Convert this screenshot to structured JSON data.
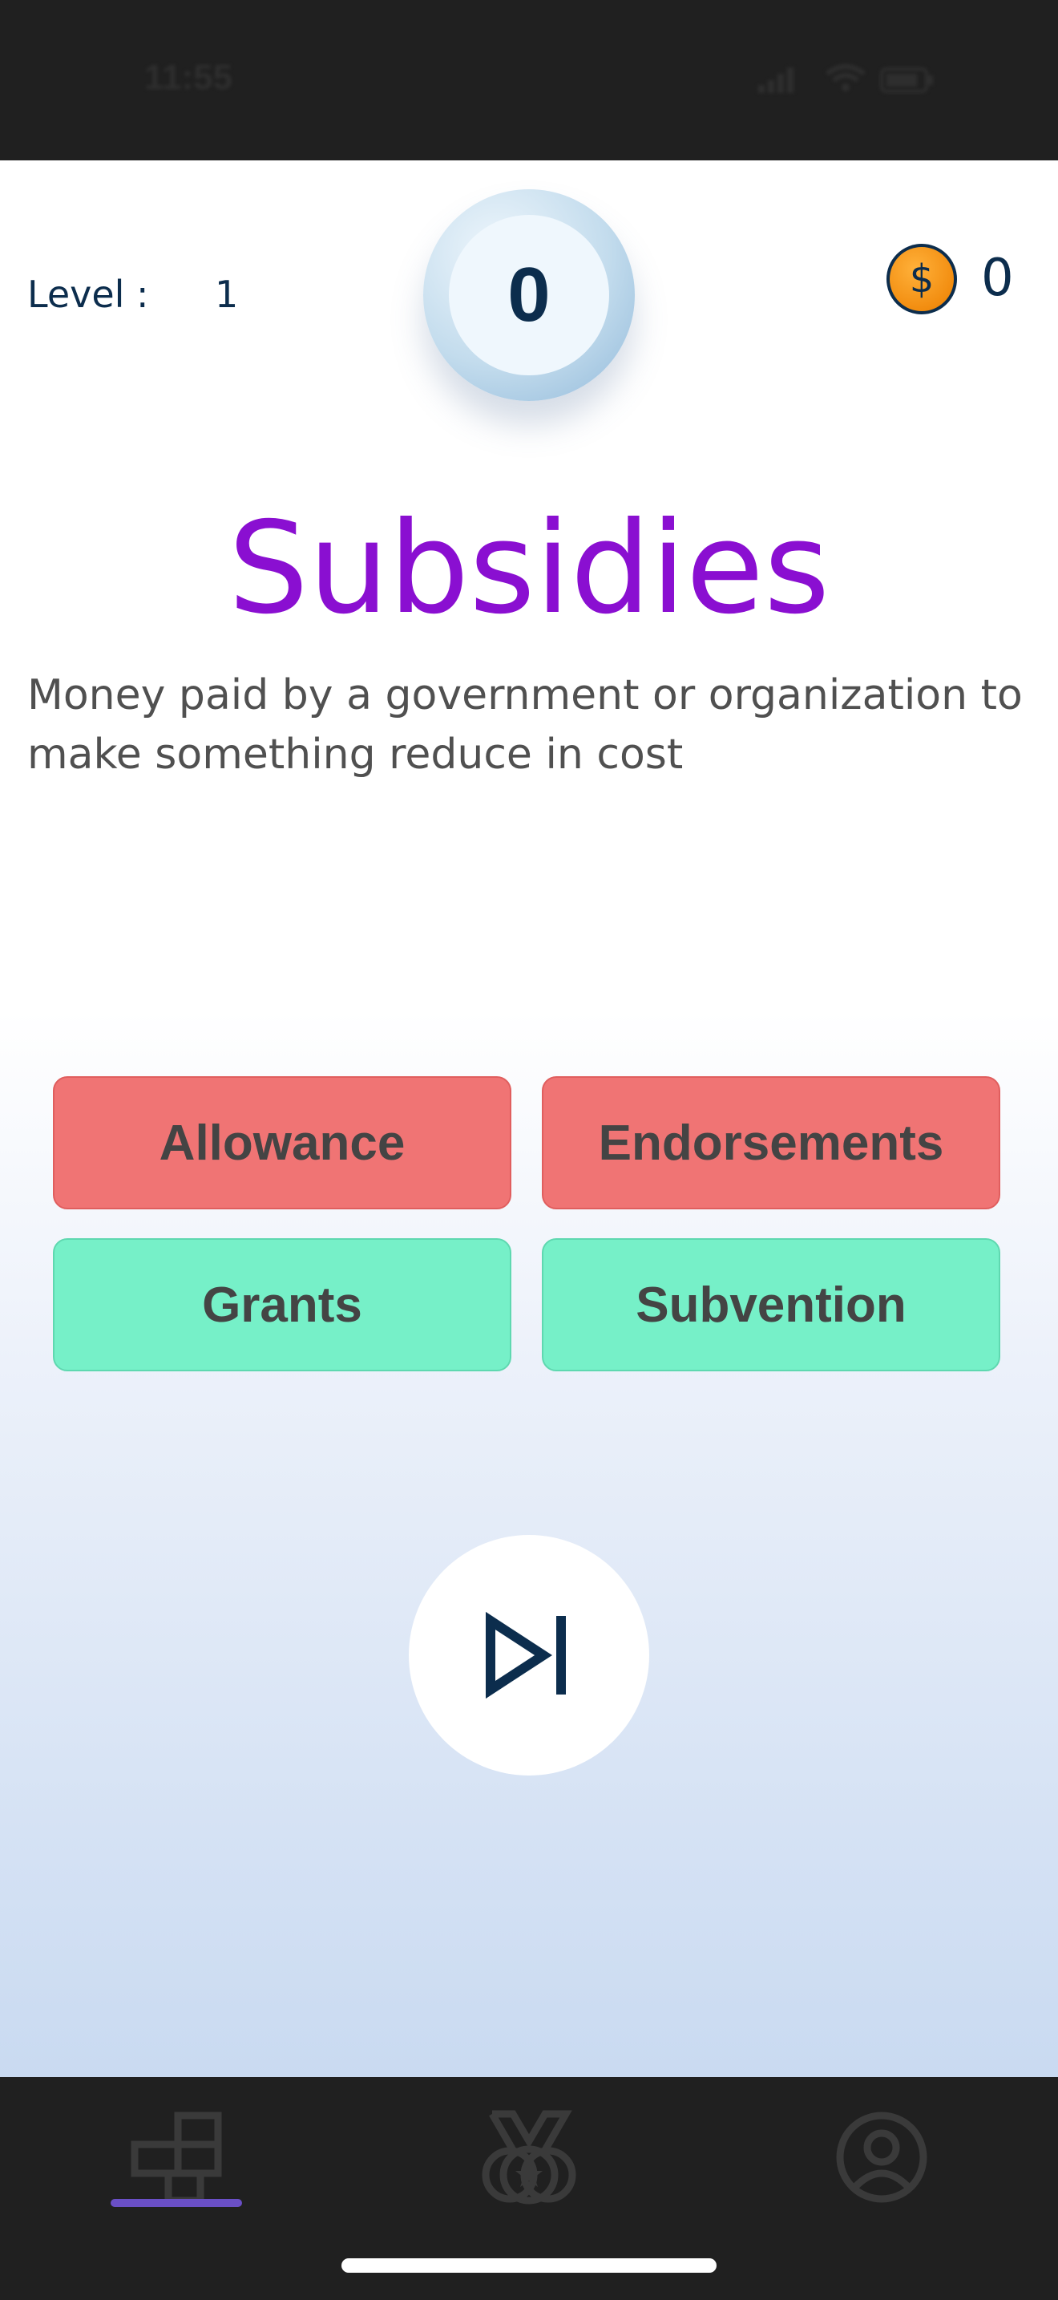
{
  "status_bar": {
    "time": "11:55"
  },
  "header": {
    "level_label": "Level :",
    "level_value": "1",
    "score": "0",
    "coin_symbol": "$",
    "coins": "0"
  },
  "question": {
    "word": "Subsidies",
    "definition": "Money paid by a government or organization to make something reduce in cost"
  },
  "answers": [
    {
      "label": "Allowance",
      "state": "incorrect",
      "color": "#f07474"
    },
    {
      "label": "Endorsements",
      "state": "incorrect",
      "color": "#f07474"
    },
    {
      "label": "Grants",
      "state": "correct",
      "color": "#76f0c8"
    },
    {
      "label": "Subvention",
      "state": "correct",
      "color": "#76f0c8"
    }
  ],
  "skip": {
    "icon": "skip-next-icon"
  },
  "bottom_nav": {
    "tabs": [
      {
        "icon": "puzzle-grid-icon",
        "active": true
      },
      {
        "icon": "medal-icon",
        "active": false
      },
      {
        "icon": "profile-icon",
        "active": false
      }
    ],
    "active_color": "#6a4fc6"
  },
  "colors": {
    "accent_word": "#8a0fd1",
    "navy": "#0c2d4d",
    "coin": "#f28d10"
  }
}
